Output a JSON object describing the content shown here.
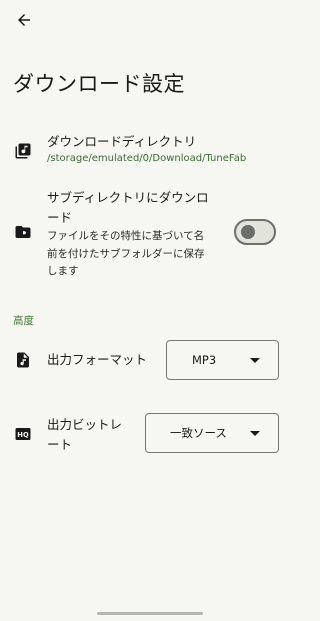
{
  "header": {
    "back_icon": "arrow-left-icon",
    "title": "ダウンロード設定"
  },
  "download_directory": {
    "icon": "library-music-icon",
    "title": "ダウンロードディレクトリ",
    "path": "/storage/emulated/0/Download/TuneFab"
  },
  "subdirectory": {
    "icon": "folder-icon",
    "title_line1": "サブディレクトリにダウンロ",
    "title_line2": "ード",
    "desc_line1": "ファイルをその特性に基づいて名",
    "desc_line2": "前を付けたサブフォルダーに保存",
    "desc_line3": "します",
    "toggle_on": false
  },
  "advanced": {
    "label": "高度"
  },
  "output_format": {
    "icon": "music-file-icon",
    "label": "出力フォーマット",
    "value": "MP3"
  },
  "output_bitrate": {
    "icon": "hq-icon",
    "label_line1": "出力ビットレ",
    "label_line2": "ート",
    "value": "一致ソース"
  },
  "colors": {
    "background": "#f6f7f2",
    "accent_green": "#3c7a34",
    "toggle_off": "#6b6f68"
  }
}
